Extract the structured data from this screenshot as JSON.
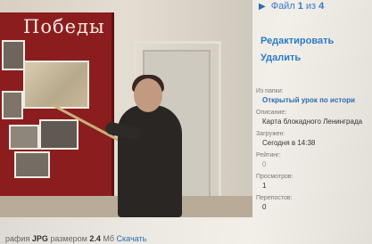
{
  "photo": {
    "banner_text": "Победы"
  },
  "nav": {
    "arrow_icon": "play-triangle-icon",
    "prefix": "Файл",
    "current": "1",
    "separator": "из",
    "total": "4"
  },
  "actions": {
    "edit_label": "Редактировать",
    "delete_label": "Удалить"
  },
  "meta": {
    "folder_label": "Из папки:",
    "folder_value": "Открытый урок по истори",
    "description_label": "Описание:",
    "description_value": "Карта блокадного Ленинграда",
    "uploaded_label": "Загружен:",
    "uploaded_value": "Сегодня в 14:38",
    "rating_label": "Рейтинг:",
    "rating_value": "0",
    "views_label": "Просмотров:",
    "views_value": "1",
    "reposts_label": "Перепостов:",
    "reposts_value": "0"
  },
  "caption": {
    "prefix": "рафия",
    "format": "JPG",
    "size_label": "размером",
    "size_value": "2.4",
    "size_unit": "Мб",
    "download_label": "Скачать"
  }
}
